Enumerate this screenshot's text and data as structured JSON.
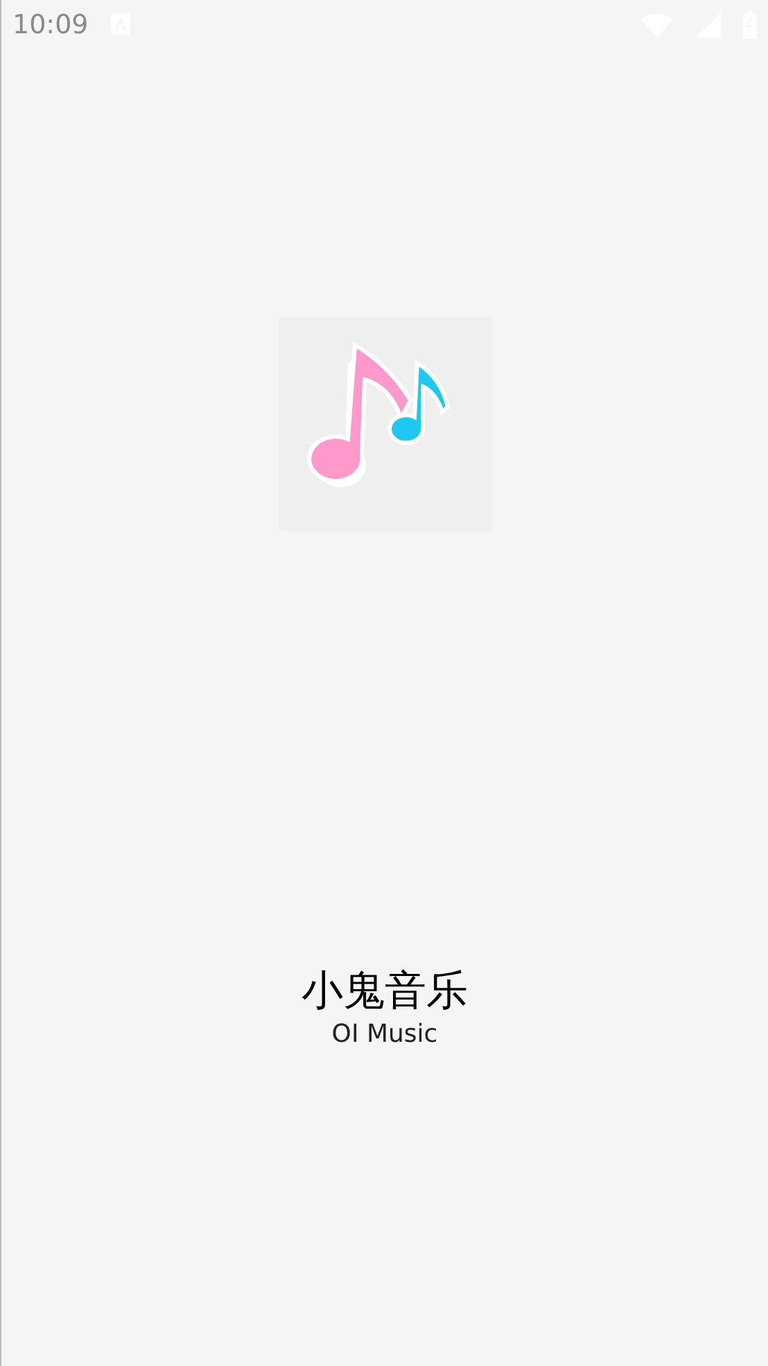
{
  "status_bar": {
    "time": "10:09"
  },
  "app": {
    "title": "小鬼音乐",
    "subtitle": "OI Music"
  }
}
